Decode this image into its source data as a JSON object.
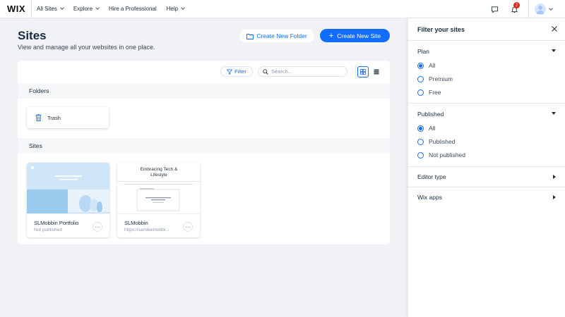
{
  "topbar": {
    "logo": "WIX",
    "nav": [
      {
        "label": "All Sites",
        "has_chevron": true
      },
      {
        "label": "Explore",
        "has_chevron": true
      },
      {
        "label": "Hire a Professional",
        "has_chevron": false
      },
      {
        "label": "Help",
        "has_chevron": true
      }
    ],
    "notification_count": "2",
    "icons": [
      "chat-icon",
      "bell-icon",
      "avatar"
    ]
  },
  "header": {
    "title": "Sites",
    "subtitle": "View and manage all your websites in one place.",
    "create_folder_label": "Create New Folder",
    "create_site_label": "Create New Site"
  },
  "toolbar": {
    "filter_label": "Filter",
    "search_placeholder": "Search...",
    "view_mode": "grid"
  },
  "folders": {
    "heading": "Folders",
    "items": [
      {
        "name": "Trash"
      }
    ]
  },
  "sites": {
    "heading": "Sites",
    "items": [
      {
        "name": "SLMobbin Portfolio",
        "sub": "Not published"
      },
      {
        "name": "SLMobbin",
        "sub": "https://samleemobbi...",
        "thumb_title": "Embracing Tech & Lifestyle"
      }
    ]
  },
  "filter_panel": {
    "title": "Filter your sites",
    "plan": {
      "title": "Plan",
      "options": [
        "All",
        "Premium",
        "Free"
      ],
      "selected": "All"
    },
    "published": {
      "title": "Published",
      "options": [
        "All",
        "Published",
        "Not published"
      ],
      "selected": "All"
    },
    "editor_type": {
      "title": "Editor type"
    },
    "wix_apps": {
      "title": "Wix apps"
    }
  },
  "colors": {
    "accent": "#116dff",
    "background": "#f0f2f5",
    "badge": "#e62214"
  }
}
